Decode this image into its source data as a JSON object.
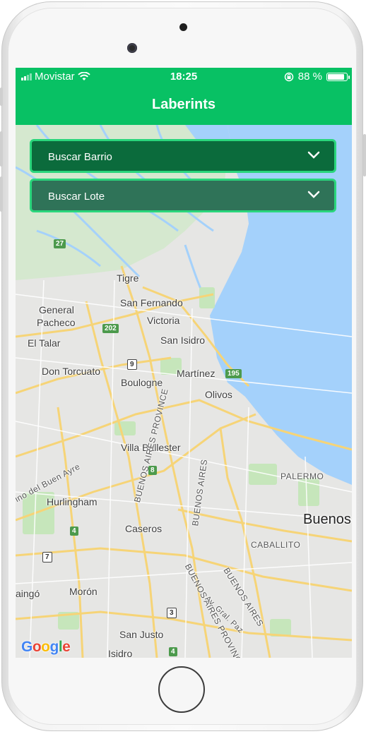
{
  "status_bar": {
    "carrier": "Movistar",
    "time": "18:25",
    "battery_percent": "88 %",
    "battery_level": 0.88
  },
  "app": {
    "title": "Laberints"
  },
  "search": {
    "barrio_label": "Buscar Barrio",
    "lote_label": "Buscar Lote"
  },
  "map": {
    "labels": {
      "tigre": "Tigre",
      "san_fernando": "San Fernando",
      "general_pacheco_1": "General",
      "general_pacheco_2": "Pacheco",
      "victoria": "Victoria",
      "san_isidro": "San Isidro",
      "el_talar": "El Talar",
      "don_torcuato": "Don Torcuato",
      "boulogne": "Boulogne",
      "martinez": "Martínez",
      "olivos": "Olivos",
      "villa_ballester": "Villa Ballester",
      "palermo": "PALERMO",
      "hurlingham": "Hurlingham",
      "buenos_aires": "Buenos",
      "caseros": "Caseros",
      "caballito": "CABALLITO",
      "buenos_aires_province_1": "BUENOS AIRES PROVINCE",
      "buenos_aires_province_2": "BUENOS AIRES",
      "buenos_aires_province_3": "BUENOS AIRES",
      "buenos_aires_province_4": "BUENOS AIRES PROVINCE",
      "camino_del_buen_ayre": "ino del Buen Ayre",
      "ituzaingo": "aingó",
      "moron": "Morón",
      "av_gral_paz": "Av. Gral. Paz",
      "san_justo": "San Justo",
      "isidro": "Isidro"
    },
    "shields": {
      "r27": "27",
      "r202": "202",
      "r9": "9",
      "r195": "195",
      "r8": "8",
      "r4a": "4",
      "r7": "7",
      "r3": "3",
      "r4b": "4"
    },
    "attribution": "Google"
  }
}
